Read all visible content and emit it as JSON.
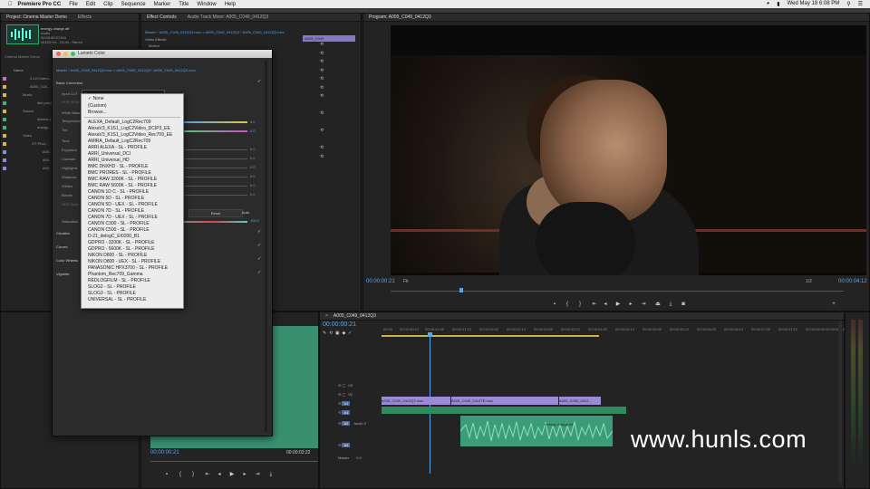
{
  "menubar": {
    "app": "Premiere Pro CC",
    "items": [
      "File",
      "Edit",
      "Clip",
      "Sequence",
      "Marker",
      "Title",
      "Window",
      "Help"
    ],
    "datetime": "Wed May 18 6:08 PM"
  },
  "project_panel": {
    "tabs": [
      "Project: Cinema Master Demo",
      "Effects"
    ],
    "clip_name": "energy-charge.aif",
    "clip_meta": [
      "Audio",
      "00:00:50:27104",
      "44100 Hz - 24-bit - Stereo"
    ],
    "search_label": "Cinema Master Demo",
    "name_header": "Name",
    "tree": [
      "2-10 Cinem...",
      "A005_C04...",
      "Music",
      "diet prod...",
      "Sound",
      "electro-c...",
      "energy-...",
      "Video",
      "GT Phot...",
      "A00...",
      "A00...",
      "A00..."
    ]
  },
  "effect_controls": {
    "tabs": [
      "Effect Controls",
      "Audio Track Mixer: A005_C049_0412Q3"
    ],
    "source_line": "Master * A005_C049_0412Q3.mov > A005_C049_0412Q3 * A005_C049_0412Q3.mov",
    "clip_tab": "A005_C049",
    "section": "Video Effects",
    "motion": "Motion"
  },
  "program": {
    "title": "Program: A005_C049_0412Q3",
    "timecode_in": "00:00:00:21",
    "timecode_out": "00:00:04:12",
    "fit": "Fit",
    "resolution": "1/2"
  },
  "lumetri": {
    "title": "Lumetri Color",
    "source_line": "Master * A005_C049_0412Q3.mov > A005_C049_0412Q3 * A005_C049_0412Q3.mov",
    "basic_correction": "Basic Correction",
    "input_lut_label": "Input LUT",
    "input_lut_value": "None",
    "hdr_label": "HDR White",
    "white_balance": "White Balance",
    "temperature": "Temperature",
    "tint": "Tint",
    "tone": "Tone",
    "tone_rows": [
      "Exposure",
      "Contrast",
      "Highlights",
      "Shadows",
      "Whites",
      "Blacks",
      "HDR Spec"
    ],
    "value": "0.0",
    "reset": "Reset",
    "auto": "Auto",
    "saturation": "Saturation",
    "saturation_value": "100.0",
    "sections": [
      "Creative",
      "Curves",
      "Color Wheels",
      "Vignette"
    ]
  },
  "lut_menu": {
    "options": [
      "None",
      "(Custom)",
      "Browse...",
      "ALEXA_Default_LogC2Rec709",
      "AlexaV3_K1S1_LogC2Video_DCIP3_EE",
      "AlexaV3_K1S1_LogC2Video_Rec709_EE",
      "AMIRA_Default_LogC2Rec709",
      "ARRI ALEXA - SL - PROFILE",
      "ARRI_Universal_DCI",
      "ARRI_Universal_HD",
      "BMC DNXHD - SL - PROFILE",
      "BMC PRORES - SL - PROFILE",
      "BMC RAW 3200K - SL - PROFILE",
      "BMC RAW 5600K - SL - PROFILE",
      "CANON 1D C - SL - PROFILE",
      "CANON 5D - SL - PROFILE",
      "CANON 5D - UEX - SL - PROFILE",
      "CANON 7D - SL - PROFILE",
      "CANON 7D - UEX - SL - PROFILE",
      "CANON C300 - SL - PROFILE",
      "CANON C500 - SL - PROFILE",
      "D-21_delogC_EI0200_B1",
      "GDPRO - 3200K - SL - PROFILE",
      "GDPRO - 5600K - SL - PROFILE",
      "NIKON D800 - SL - PROFILE",
      "NIKON D800 - UEX - SL - PROFILE",
      "PANASONIC HPX3700 - SL - PROFILE",
      "Phantom_Rec709_Gamma",
      "REDLOGFILM - SL - PROFILE",
      "SLOG2 - SL - PROFILE",
      "SLOG3 - SL - PROFILE",
      "UNIVERSAL - SL - PROFILE"
    ]
  },
  "source_monitor": {
    "timecode_in": "00:00:00:21",
    "timecode_out": "00:00:03:22"
  },
  "timeline": {
    "sequence": "A005_C049_0412Q3",
    "timecode": "00:00:00:21",
    "ruler": [
      "00:00",
      "00:00:00:12",
      "00:00:01:00",
      "00:00:01:12",
      "00:00:02:00",
      "00:00:02:12",
      "00:00:03:00",
      "00:00:03:12",
      "00:00:04:00",
      "00:00:04:12",
      "00:00:05:00",
      "00:00:05:12",
      "00:00:06:00",
      "00:00:06:12",
      "00:00:07:00",
      "00:00:07:12",
      "00:00:08:00",
      "00:00:08:12",
      "00:00:09:00"
    ],
    "tracks": [
      "V3",
      "V2",
      "V1",
      "A1",
      "A2",
      "A3",
      "Master"
    ],
    "audio_label": "Audio 2",
    "master_value": "0.0",
    "clips": [
      "A005_C049_0412Q3.mov",
      "A005_C049_0412TE.mov",
      "A005_C050_0412..."
    ],
    "audio_clip": "energy-charge.aif"
  },
  "watermark": "www.hunls.com",
  "colors": {
    "timecode": "#5aa6e8",
    "video_clip": "#9b8ad6",
    "audio_clip": "#3c9c7a"
  }
}
